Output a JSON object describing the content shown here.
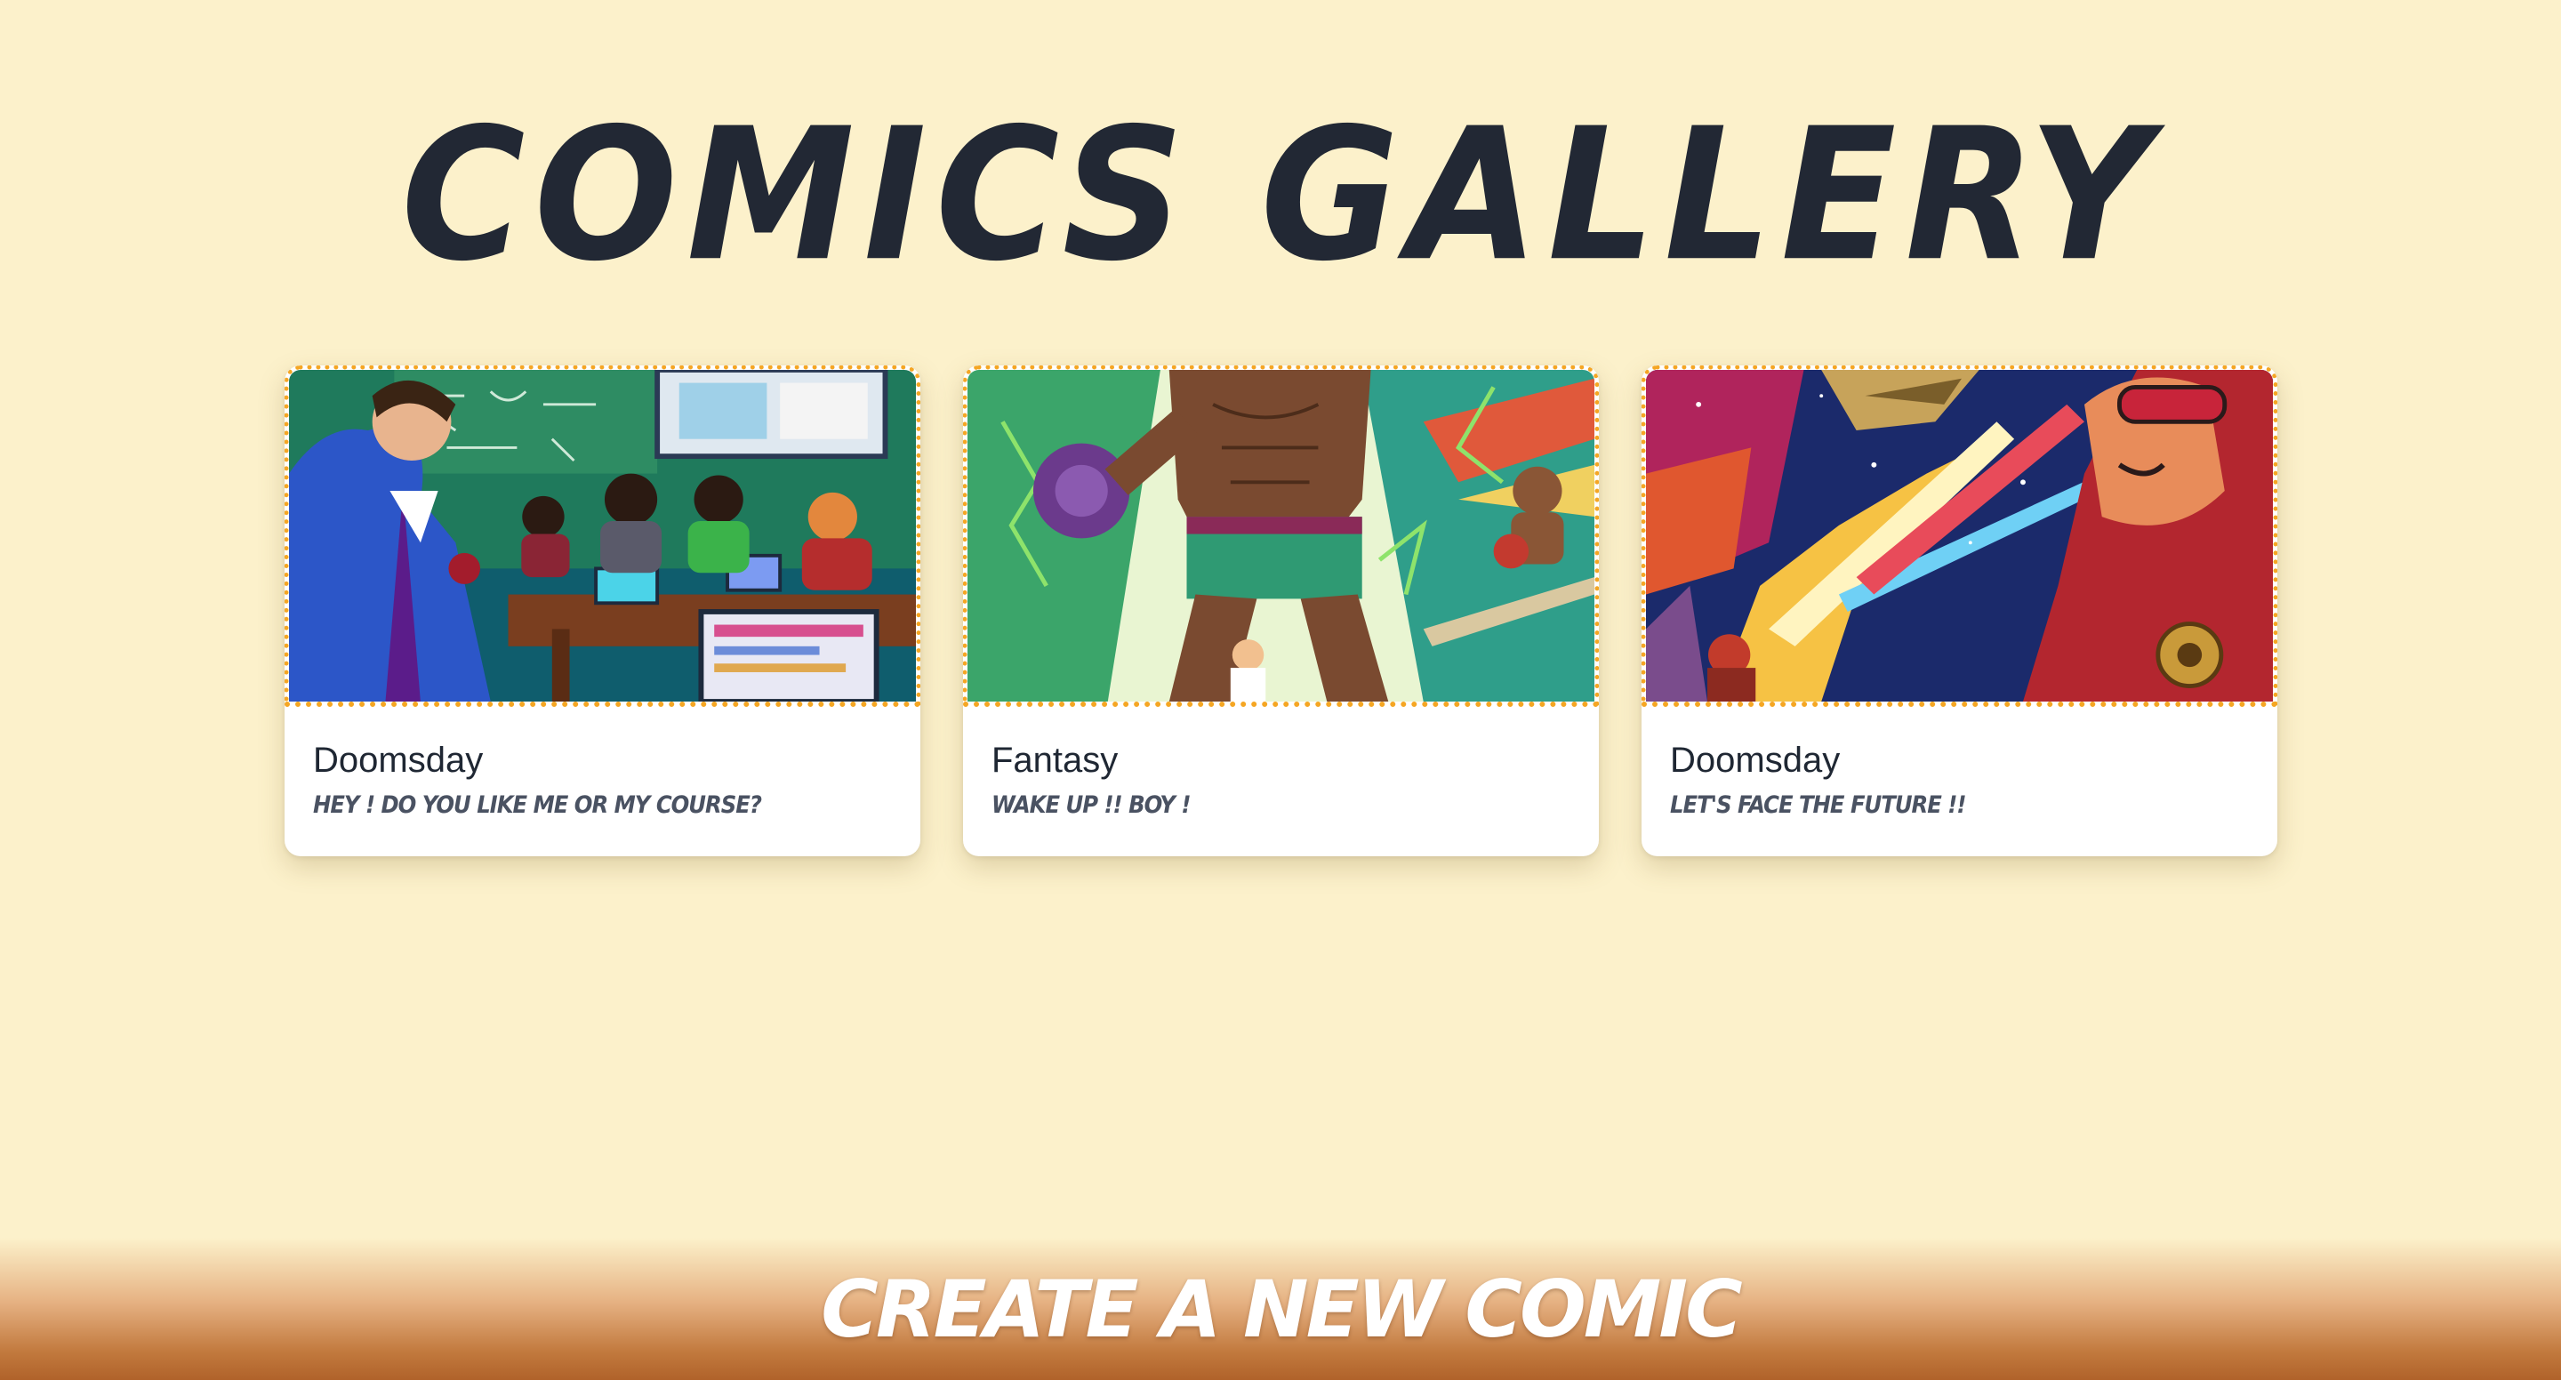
{
  "page": {
    "title": "COMICS GALLERY"
  },
  "comics": [
    {
      "title": "Doomsday",
      "caption": "HEY ! DO YOU LIKE ME OR MY COURSE?",
      "image_alt": "classroom-comic-illustration"
    },
    {
      "title": "Fantasy",
      "caption": "WAKE UP !! BOY !",
      "image_alt": "boxer-comic-illustration"
    },
    {
      "title": "Doomsday",
      "caption": "LET'S FACE THE FUTURE !!",
      "image_alt": "space-pilot-comic-illustration"
    }
  ],
  "footer": {
    "create_label": "CREATE A NEW COMIC"
  },
  "colors": {
    "background": "#fcf1cb",
    "title": "#222834",
    "card_border": "#f5a623",
    "footer_gradient_end": "#b0622a"
  }
}
